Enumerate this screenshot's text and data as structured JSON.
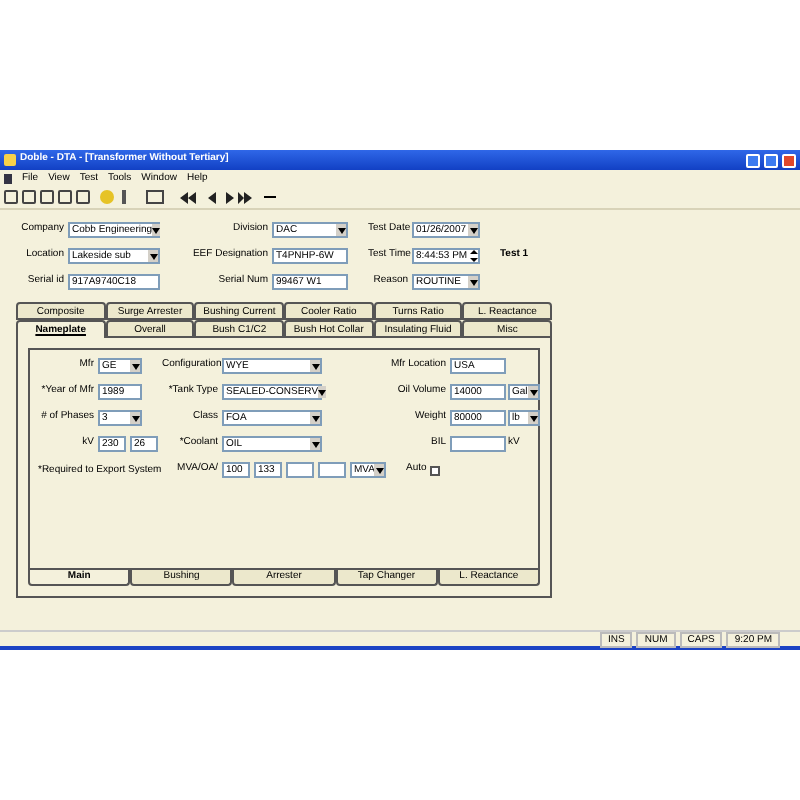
{
  "window": {
    "title": "Doble - DTA - [Transformer Without Tertiary]"
  },
  "menu": [
    "File",
    "View",
    "Test",
    "Tools",
    "Window",
    "Help"
  ],
  "header": {
    "rows": [
      [
        {
          "label": "Company",
          "kind": "dropdown",
          "value": "Cobb Engineering"
        },
        {
          "label": "Division",
          "kind": "dropdown",
          "value": "DAC"
        },
        {
          "label": "Test Date",
          "kind": "dropdown",
          "value": "01/26/2007"
        }
      ],
      [
        {
          "label": "Location",
          "kind": "dropdown",
          "value": "Lakeside sub"
        },
        {
          "label": "EEF Designation",
          "kind": "text",
          "value": "T4PNHP-6W"
        },
        {
          "label": "Test Time",
          "kind": "spin",
          "value": "8:44:53 PM"
        }
      ],
      [
        {
          "label": "Serial id",
          "kind": "text",
          "value": "917A9740C18"
        },
        {
          "label": "Serial Num",
          "kind": "text",
          "value": "99467 W1"
        },
        {
          "label": "Reason",
          "kind": "dropdown",
          "value": "ROUTINE"
        }
      ]
    ],
    "test_label": "Test 1"
  },
  "tab_rows": [
    [
      {
        "label": "Composite",
        "selected": false
      },
      {
        "label": "Surge Arrester",
        "selected": false
      },
      {
        "label": "Bushing Current",
        "selected": false
      },
      {
        "label": "Cooler Ratio",
        "selected": false
      },
      {
        "label": "Turns Ratio",
        "selected": false
      },
      {
        "label": "L. Reactance",
        "selected": false
      }
    ],
    [
      {
        "label": "Nameplate",
        "selected": true
      },
      {
        "label": "Overall",
        "selected": false
      },
      {
        "label": "Bush C1/C2",
        "selected": false
      },
      {
        "label": "Bush Hot Collar",
        "selected": false
      },
      {
        "label": "Insulating Fluid",
        "selected": false
      },
      {
        "label": "Misc",
        "selected": false
      }
    ]
  ],
  "panel": {
    "rows": [
      [
        {
          "label": "Mfr",
          "kind": "dropdown",
          "value": "GE"
        },
        {
          "label": "Configuration",
          "kind": "dropdown",
          "value": "WYE"
        },
        {
          "label": "Mfr Location",
          "kind": "text",
          "value": "USA"
        }
      ],
      [
        {
          "label": "*Year of Mfr",
          "kind": "text",
          "value": "1989"
        },
        {
          "label": "*Tank Type",
          "kind": "dropdown",
          "value": "SEALED-CONSERV"
        },
        {
          "label": "Oil Volume",
          "kind": "text",
          "value": "14000",
          "unit": "Gal"
        }
      ],
      [
        {
          "label": "# of Phases",
          "kind": "dropdown",
          "value": "3"
        },
        {
          "label": "Class",
          "kind": "dropdown",
          "value": "FOA"
        },
        {
          "label": "Weight",
          "kind": "text",
          "value": "80000",
          "unit": "lb"
        }
      ],
      [
        {
          "label": "kV",
          "kind": "multi",
          "boxes": [
            {
              "kind": "filled",
              "value": "230"
            },
            {
              "kind": "filled",
              "value": "26"
            }
          ]
        },
        {
          "label": "*Coolant",
          "kind": "dropdown",
          "value": "OIL"
        },
        {
          "label": "BIL",
          "kind": "text",
          "suffix": "kV"
        }
      ],
      [
        {
          "kind": "note",
          "label": "*Required to Export System"
        },
        {
          "label": "MVA/OA/",
          "kind": "multi",
          "boxes": [
            {
              "kind": "filled",
              "value": "100"
            },
            {
              "kind": "filled",
              "value": "133"
            },
            {
              "kind": "blank"
            },
            {
              "kind": "blank"
            }
          ],
          "unit": "MVA"
        },
        {
          "label": "Auto",
          "kind": "check",
          "checked": false
        }
      ]
    ]
  },
  "bottom_tabs": [
    {
      "label": "Main",
      "selected": true
    },
    {
      "label": "Bushing",
      "selected": false
    },
    {
      "label": "Arrester",
      "selected": false
    },
    {
      "label": "Tap Changer",
      "selected": false
    },
    {
      "label": "L. Reactance",
      "selected": false
    }
  ],
  "status_bar": [
    "INS",
    "NUM",
    "CAPS",
    "9:20 PM"
  ]
}
